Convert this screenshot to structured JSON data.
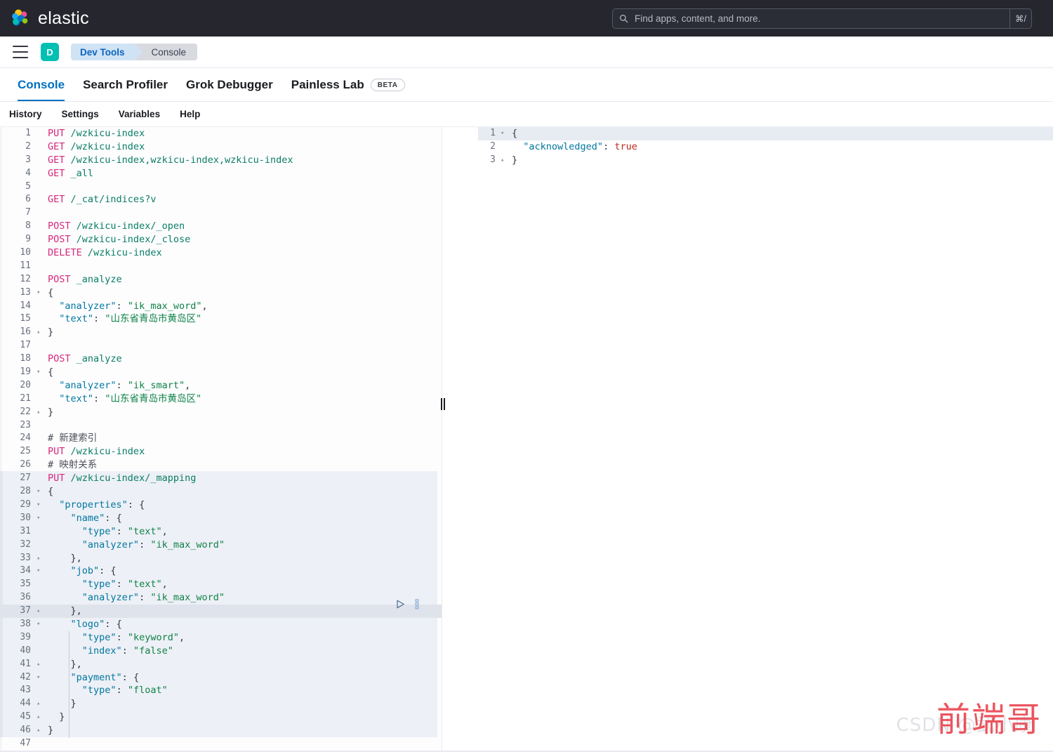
{
  "header": {
    "brand_name": "elastic",
    "logo_icon": "elastic-logo-icon",
    "search": {
      "placeholder": "Find apps, content, and more.",
      "value": "",
      "icon": "search-icon",
      "shortcut": "⌘/"
    }
  },
  "breadcrumbs": {
    "menu_icon": "hamburger-menu-icon",
    "space_initial": "D",
    "items": [
      {
        "label": "Dev Tools"
      },
      {
        "label": "Console"
      }
    ]
  },
  "app_tabs": [
    {
      "label": "Console",
      "active": true,
      "badge": ""
    },
    {
      "label": "Search Profiler",
      "active": false,
      "badge": ""
    },
    {
      "label": "Grok Debugger",
      "active": false,
      "badge": ""
    },
    {
      "label": "Painless Lab",
      "active": false,
      "badge": "BETA"
    }
  ],
  "console_toolbar": [
    {
      "label": "History"
    },
    {
      "label": "Settings"
    },
    {
      "label": "Variables"
    },
    {
      "label": "Help"
    }
  ],
  "actions": {
    "play_icon": "play-triangle-icon",
    "wrench_icon": "wrench-icon",
    "splitter": "panel-resize-handle"
  },
  "editor": {
    "lines": [
      {
        "n": "1",
        "fold": "",
        "text": "PUT /wzkicu-index"
      },
      {
        "n": "2",
        "fold": "",
        "text": "GET /wzkicu-index"
      },
      {
        "n": "3",
        "fold": "",
        "text": "GET /wzkicu-index,wzkicu-index,wzkicu-index"
      },
      {
        "n": "4",
        "fold": "",
        "text": "GET _all"
      },
      {
        "n": "5",
        "fold": "",
        "text": ""
      },
      {
        "n": "6",
        "fold": "",
        "text": "GET /_cat/indices?v"
      },
      {
        "n": "7",
        "fold": "",
        "text": ""
      },
      {
        "n": "8",
        "fold": "",
        "text": "POST /wzkicu-index/_open"
      },
      {
        "n": "9",
        "fold": "",
        "text": "POST /wzkicu-index/_close"
      },
      {
        "n": "10",
        "fold": "",
        "text": "DELETE /wzkicu-index"
      },
      {
        "n": "11",
        "fold": "",
        "text": ""
      },
      {
        "n": "12",
        "fold": "",
        "text": "POST _analyze"
      },
      {
        "n": "13",
        "fold": "▾",
        "text": "{"
      },
      {
        "n": "14",
        "fold": "",
        "text": "  \"analyzer\": \"ik_max_word\","
      },
      {
        "n": "15",
        "fold": "",
        "text": "  \"text\": \"山东省青岛市黄岛区\""
      },
      {
        "n": "16",
        "fold": "▴",
        "text": "}"
      },
      {
        "n": "17",
        "fold": "",
        "text": ""
      },
      {
        "n": "18",
        "fold": "",
        "text": "POST _analyze"
      },
      {
        "n": "19",
        "fold": "▾",
        "text": "{"
      },
      {
        "n": "20",
        "fold": "",
        "text": "  \"analyzer\": \"ik_smart\","
      },
      {
        "n": "21",
        "fold": "",
        "text": "  \"text\": \"山东省青岛市黄岛区\""
      },
      {
        "n": "22",
        "fold": "▴",
        "text": "}"
      },
      {
        "n": "23",
        "fold": "",
        "text": ""
      },
      {
        "n": "24",
        "fold": "",
        "text": "# 新建索引"
      },
      {
        "n": "25",
        "fold": "",
        "text": "PUT /wzkicu-index"
      },
      {
        "n": "26",
        "fold": "",
        "text": "# 映射关系"
      },
      {
        "n": "27",
        "fold": "",
        "text": "PUT /wzkicu-index/_mapping"
      },
      {
        "n": "28",
        "fold": "▾",
        "text": "{"
      },
      {
        "n": "29",
        "fold": "▾",
        "text": "  \"properties\": {"
      },
      {
        "n": "30",
        "fold": "▾",
        "text": "    \"name\": {"
      },
      {
        "n": "31",
        "fold": "",
        "text": "      \"type\": \"text\","
      },
      {
        "n": "32",
        "fold": "",
        "text": "      \"analyzer\": \"ik_max_word\""
      },
      {
        "n": "33",
        "fold": "▴",
        "text": "    },"
      },
      {
        "n": "34",
        "fold": "▾",
        "text": "    \"job\": {"
      },
      {
        "n": "35",
        "fold": "",
        "text": "      \"type\": \"text\","
      },
      {
        "n": "36",
        "fold": "",
        "text": "      \"analyzer\": \"ik_max_word\""
      },
      {
        "n": "37",
        "fold": "▴",
        "text": "    },"
      },
      {
        "n": "38",
        "fold": "▾",
        "text": "    \"logo\": {"
      },
      {
        "n": "39",
        "fold": "",
        "text": "      \"type\": \"keyword\","
      },
      {
        "n": "40",
        "fold": "",
        "text": "      \"index\": \"false\""
      },
      {
        "n": "41",
        "fold": "▴",
        "text": "    },"
      },
      {
        "n": "42",
        "fold": "▾",
        "text": "    \"payment\": {"
      },
      {
        "n": "43",
        "fold": "",
        "text": "      \"type\": \"float\""
      },
      {
        "n": "44",
        "fold": "▴",
        "text": "    }"
      },
      {
        "n": "45",
        "fold": "▴",
        "text": "  }"
      },
      {
        "n": "46",
        "fold": "▴",
        "text": "}"
      },
      {
        "n": "47",
        "fold": "",
        "text": ""
      }
    ]
  },
  "response": {
    "lines": [
      {
        "n": "1",
        "fold": "▾",
        "text": "{"
      },
      {
        "n": "2",
        "fold": "",
        "text": "  \"acknowledged\": true"
      },
      {
        "n": "3",
        "fold": "▴",
        "text": "}"
      }
    ]
  },
  "watermark": {
    "main": "前端哥",
    "sub": "CSDN @武小康"
  },
  "colors": {
    "header_bg": "#25262e",
    "accent_blue": "#0071c2",
    "space_avatar": "#00bfb3",
    "method": "#d6287b",
    "url": "#0a7d66",
    "key": "#0077a0",
    "string": "#108248",
    "boolean": "#bd271e",
    "highlight_block": "#edf0f6",
    "active_line": "#dfe3eb",
    "watermark_red": "#e8303c"
  }
}
